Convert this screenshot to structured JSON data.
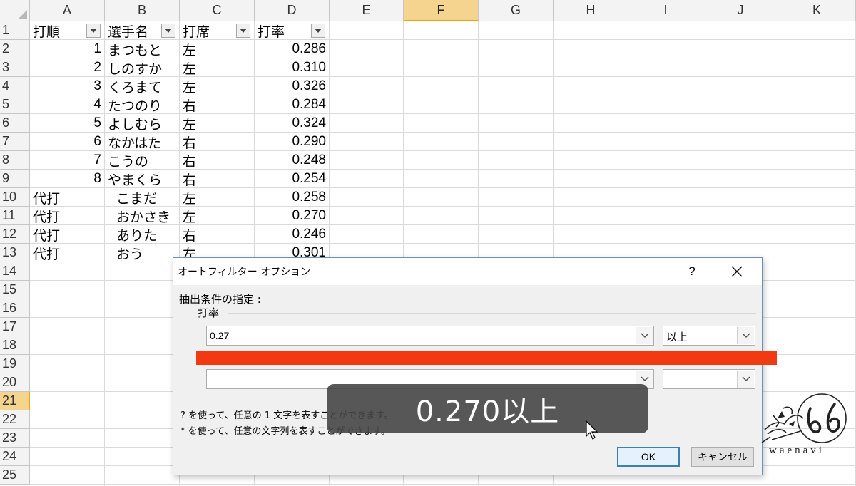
{
  "sheet": {
    "columns": [
      "A",
      "B",
      "C",
      "D",
      "E",
      "F",
      "G",
      "H",
      "I",
      "J",
      "K"
    ],
    "selected_column": "F",
    "rows": [
      "1",
      "2",
      "3",
      "4",
      "5",
      "6",
      "7",
      "8",
      "9",
      "10",
      "11",
      "12",
      "13",
      "14",
      "15",
      "16",
      "17",
      "18",
      "19",
      "20",
      "21",
      "22",
      "23",
      "24",
      "25"
    ],
    "selected_row": "21",
    "headers": [
      "打順",
      "選手名",
      "打席",
      "打率"
    ],
    "data": [
      [
        "1",
        "まつもと",
        "左",
        "0.286"
      ],
      [
        "2",
        "しのすか",
        "左",
        "0.310"
      ],
      [
        "3",
        "くろまて",
        "左",
        "0.326"
      ],
      [
        "4",
        "たつのり",
        "右",
        "0.284"
      ],
      [
        "5",
        "よしむら",
        "左",
        "0.324"
      ],
      [
        "6",
        "なかはた",
        "右",
        "0.290"
      ],
      [
        "7",
        "こうの",
        "右",
        "0.248"
      ],
      [
        "8",
        "やまくら",
        "右",
        "0.254"
      ],
      [
        "代打",
        "こまだ",
        "左",
        "0.258"
      ],
      [
        "代打",
        "おかさき",
        "左",
        "0.270"
      ],
      [
        "代打",
        "ありた",
        "右",
        "0.246"
      ],
      [
        "代打",
        "おう",
        "左",
        "0.301"
      ]
    ]
  },
  "dialog": {
    "title": "オートフィルター オプション",
    "help": "?",
    "criteria_label": "抽出条件の指定 :",
    "field_name": "打率",
    "condition1": {
      "value": "0.27",
      "operator": "以上"
    },
    "condition2": {
      "value": "",
      "operator": ""
    },
    "hint1": "? を使って、任意の 1 文字を表すことができます。",
    "hint2": "* を使って、任意の文字列を表すことができます。",
    "ok_label": "OK",
    "cancel_label": "キャンセル"
  },
  "overlay": {
    "caption": "0.270以上",
    "logo_text": "waenavi",
    "redbar_color": "#f23a12"
  }
}
